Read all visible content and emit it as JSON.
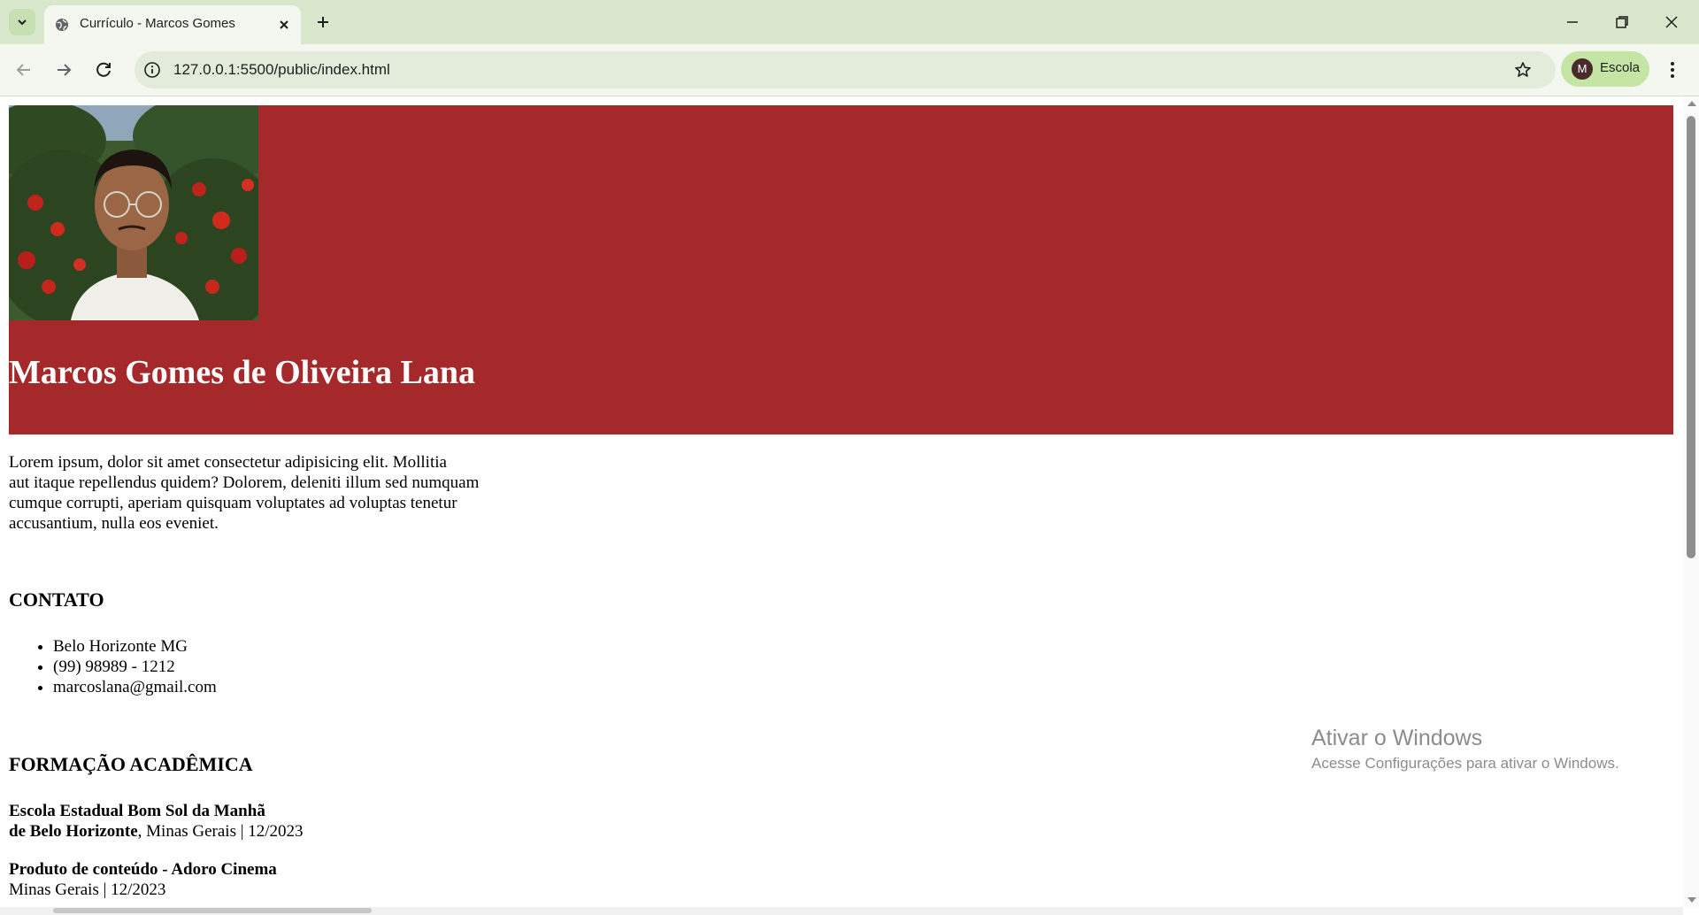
{
  "browser": {
    "tab": {
      "title": "Currículo - Marcos Gomes"
    },
    "address_bar": {
      "url": "127.0.0.1:5500/public/index.html"
    },
    "profile": {
      "initial": "M",
      "label": "Escola"
    }
  },
  "page": {
    "name": "Marcos Gomes de Oliveira Lana",
    "intro_lines": [
      "Lorem ipsum, dolor sit amet consectetur adipisicing elit. Mollitia",
      "aut itaque repellendus quidem? Dolorem, deleniti illum sed numquam",
      "cumque corrupti, aperiam quisquam voluptates ad voluptas tenetur",
      "accusantium, nulla eos eveniet."
    ],
    "contact": {
      "heading": "CONTATO",
      "items": [
        "Belo Horizonte MG",
        "(99) 98989 - 1212",
        "marcoslana@gmail.com"
      ]
    },
    "education": {
      "heading": "FORMAÇÃO ACADÊMICA",
      "entries": [
        {
          "bold_line1": "Escola Estadual Bom Sol da Manhã",
          "bold_line2": "de Belo Horizonte",
          "rest": ", Minas Gerais | 12/2023"
        },
        {
          "bold_line1": "Produto de conteúdo - Adoro Cinema",
          "rest": "Minas Gerais | 12/2023"
        }
      ]
    }
  },
  "watermark": {
    "title": "Ativar o Windows",
    "subtitle": "Acesse Configurações para ativar o Windows."
  },
  "colors": {
    "hero_bg": "#a5292a",
    "tabstrip_bg": "#d9e8cc",
    "profile_chip": "#c4e5a4"
  }
}
